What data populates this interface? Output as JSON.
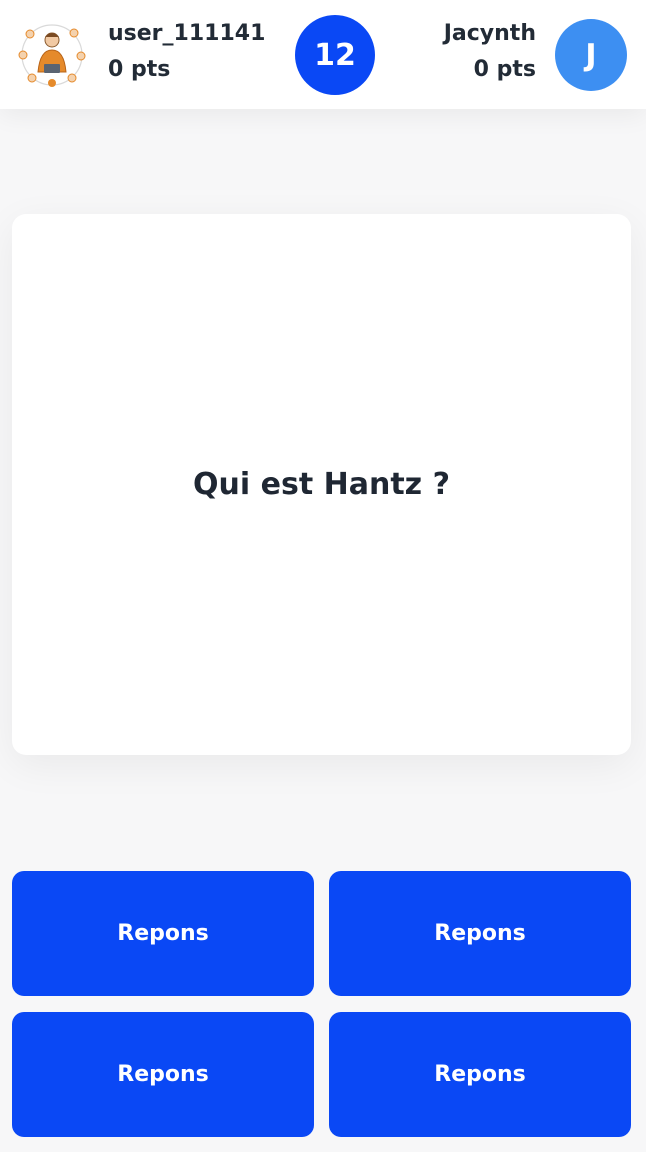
{
  "header": {
    "player": {
      "name": "user_111141",
      "score": "0 pts",
      "avatar_icon": "user-illustration-avatar-icon"
    },
    "timer": "12",
    "opponent": {
      "name": "Jacynth",
      "score": "0 pts",
      "initial": "J"
    }
  },
  "question": {
    "text": "Qui est Hantz ?"
  },
  "answers": [
    {
      "label": "Repons"
    },
    {
      "label": "Repons"
    },
    {
      "label": "Repons"
    },
    {
      "label": "Repons"
    }
  ],
  "colors": {
    "accent": "#0a48f5",
    "opponent_avatar": "#3d8ff2",
    "avatar_orange": "#e58a2b",
    "background": "#f7f7f8",
    "card": "#ffffff"
  }
}
